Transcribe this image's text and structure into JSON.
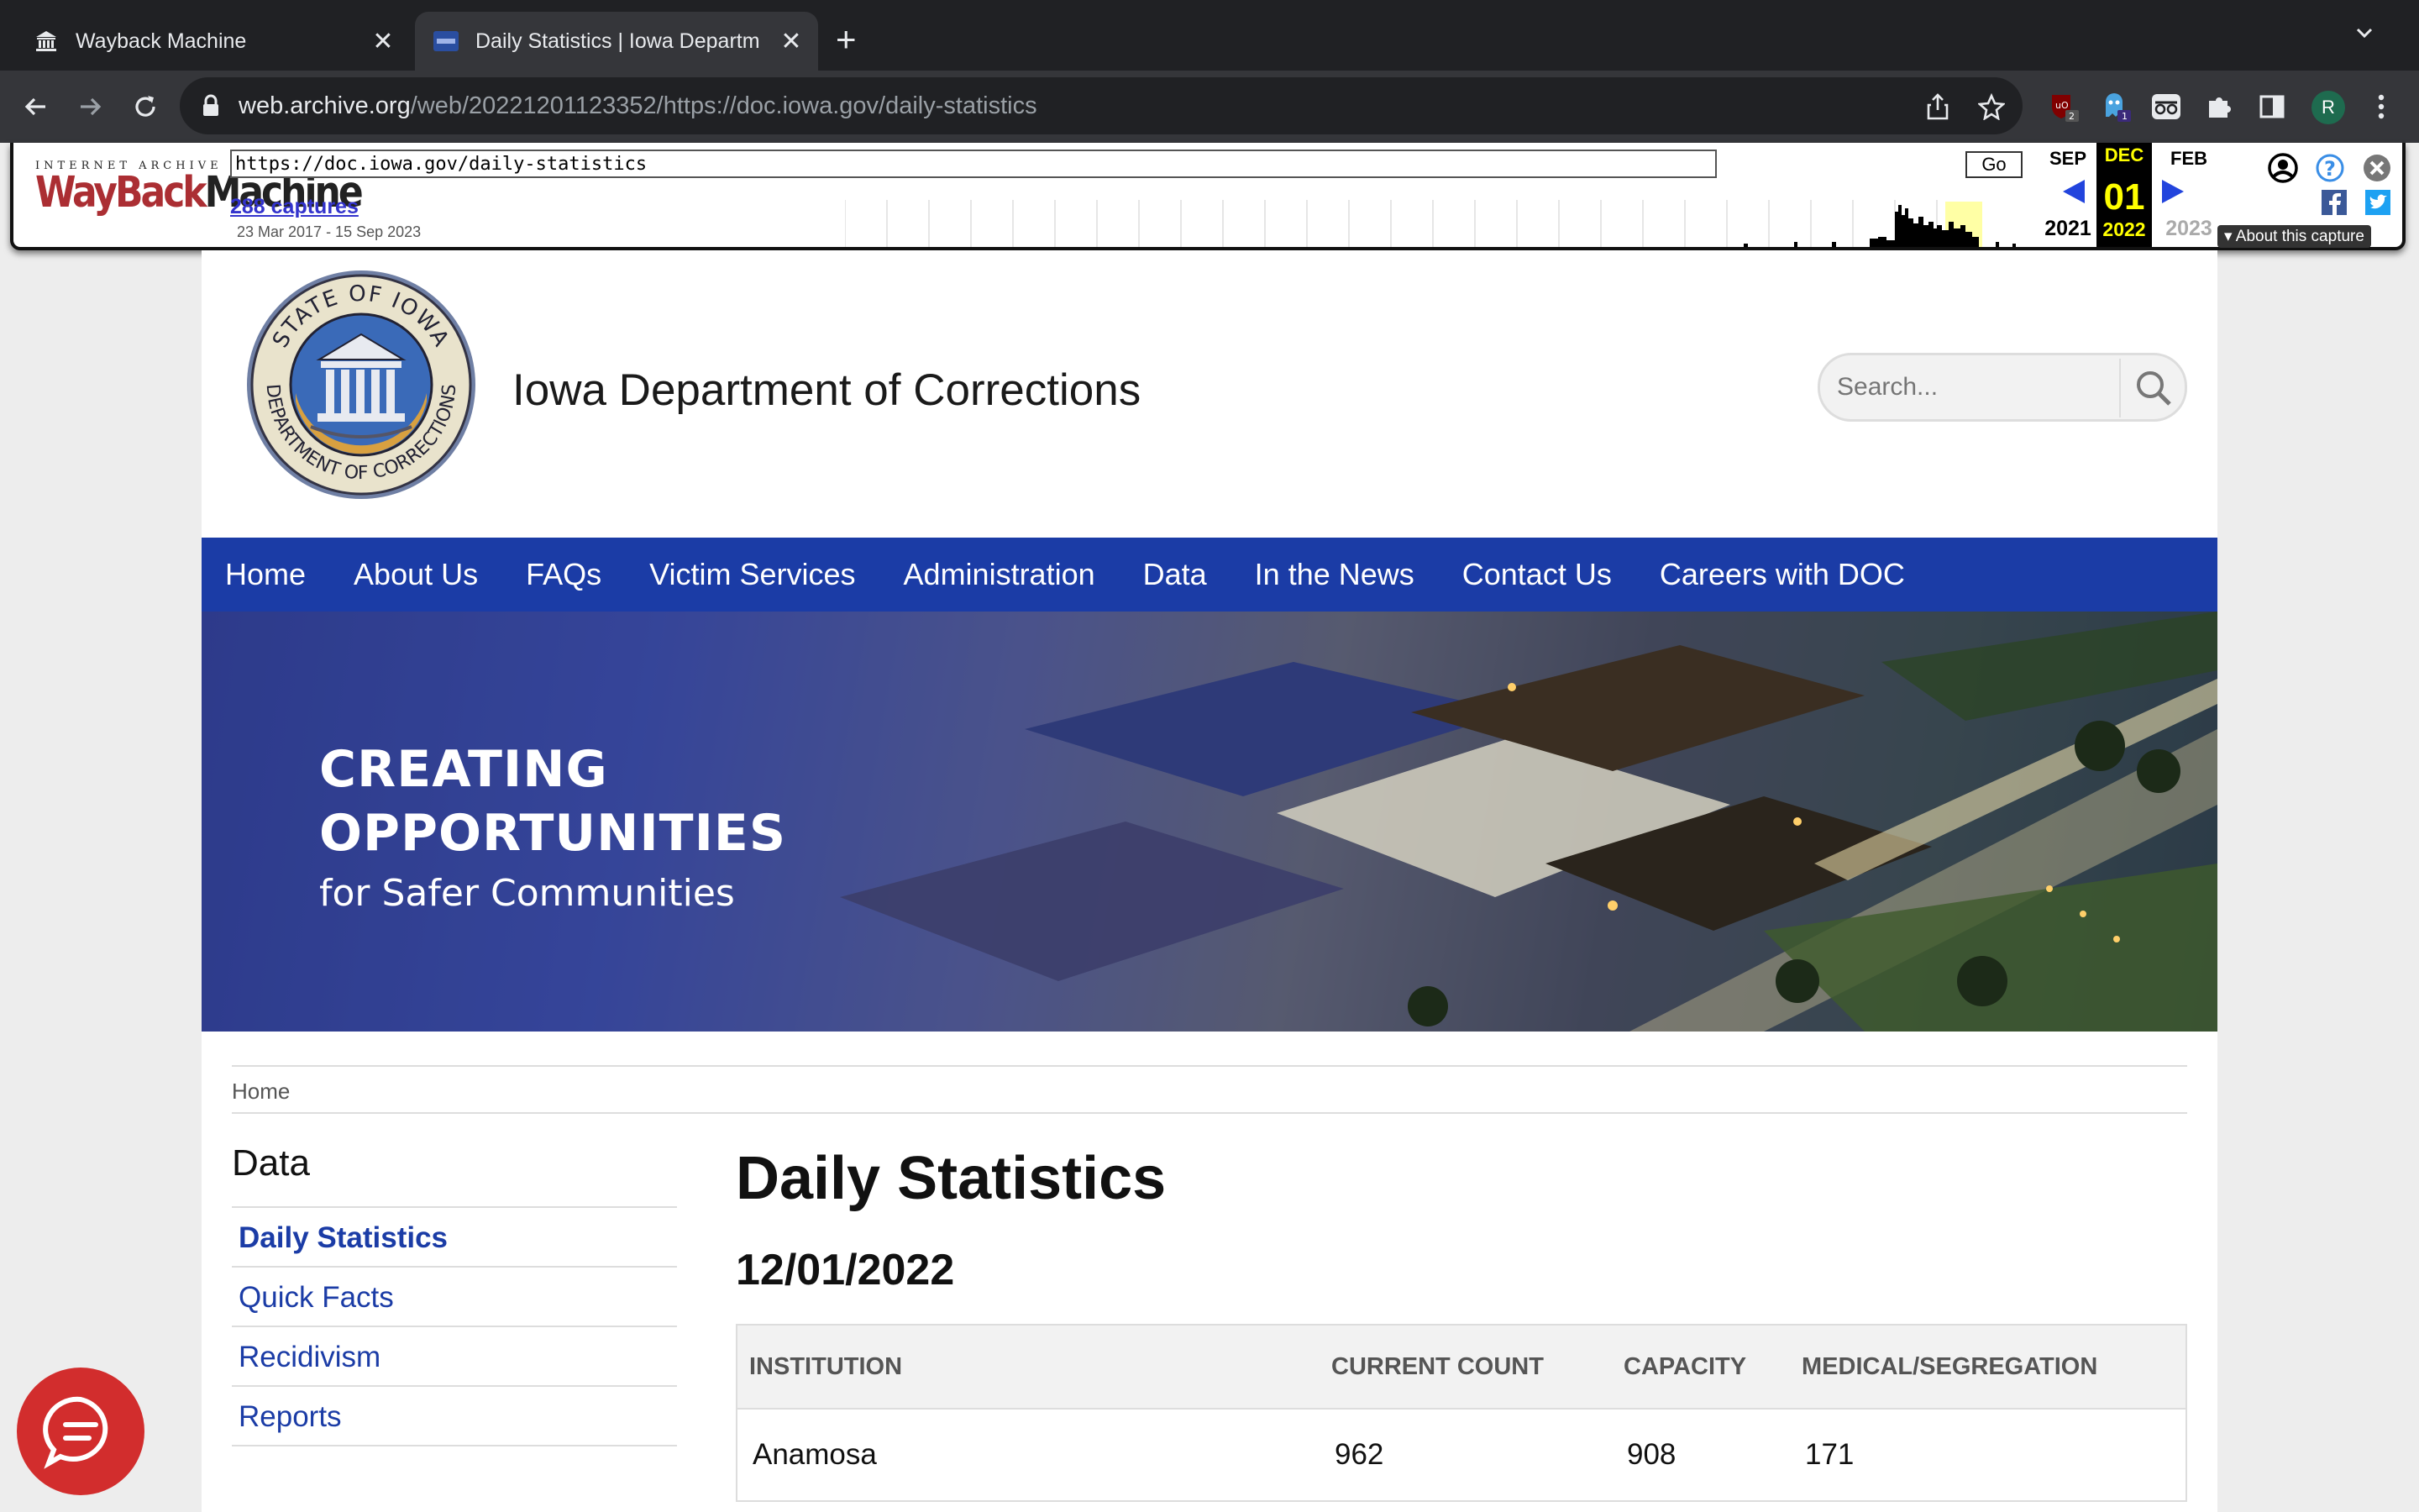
{
  "browser": {
    "tabs": [
      {
        "title": "Wayback Machine",
        "active": false
      },
      {
        "title": "Daily Statistics | Iowa Departm",
        "active": true
      }
    ],
    "url_host": "web.archive.org",
    "url_path": "/web/20221201123352/https://doc.iowa.gov/daily-statistics",
    "ext_badges": {
      "ublock": "2",
      "ghost": "1"
    },
    "profile_initial": "R"
  },
  "wayback": {
    "logo_top": "INTERNET ARCHIVE",
    "logo_way": "WayBack",
    "logo_machine": "Machine",
    "url_value": "https://doc.iowa.gov/daily-statistics",
    "go_label": "Go",
    "captures_link": "288 captures",
    "capture_range": "23 Mar 2017 - 15 Sep 2023",
    "prev": {
      "month": "SEP",
      "year": "2021"
    },
    "current": {
      "month": "DEC",
      "day": "01",
      "year": "2022"
    },
    "next": {
      "month": "FEB",
      "year": "2023"
    },
    "about_label": "About this capture"
  },
  "site": {
    "title": "Iowa Department of Corrections",
    "seal_top": "STATE OF IOWA",
    "seal_bottom": "DEPARTMENT OF CORRECTIONS",
    "search_placeholder": "Search...",
    "nav": [
      "Home",
      "About Us",
      "FAQs",
      "Victim Services",
      "Administration",
      "Data",
      "In the News",
      "Contact Us",
      "Careers with DOC"
    ],
    "hero": {
      "line1": "CREATING",
      "line2": "OPPORTUNITIES",
      "line3": "for Safer Communities"
    },
    "breadcrumb": "Home"
  },
  "sidebar": {
    "heading": "Data",
    "items": [
      {
        "label": "Daily Statistics",
        "active": true
      },
      {
        "label": "Quick Facts",
        "active": false
      },
      {
        "label": "Recidivism",
        "active": false
      },
      {
        "label": "Reports",
        "active": false
      }
    ]
  },
  "content": {
    "heading": "Daily Statistics",
    "date": "12/01/2022",
    "table": {
      "columns": [
        "INSTITUTION",
        "CURRENT COUNT",
        "CAPACITY",
        "MEDICAL/SEGREGATION"
      ],
      "rows": [
        [
          "Anamosa",
          "962",
          "908",
          "171"
        ]
      ]
    }
  },
  "colors": {
    "nav_blue": "#1b3ca6",
    "chat_red": "#d22d2d",
    "wayback_red": "#ab2e33"
  }
}
